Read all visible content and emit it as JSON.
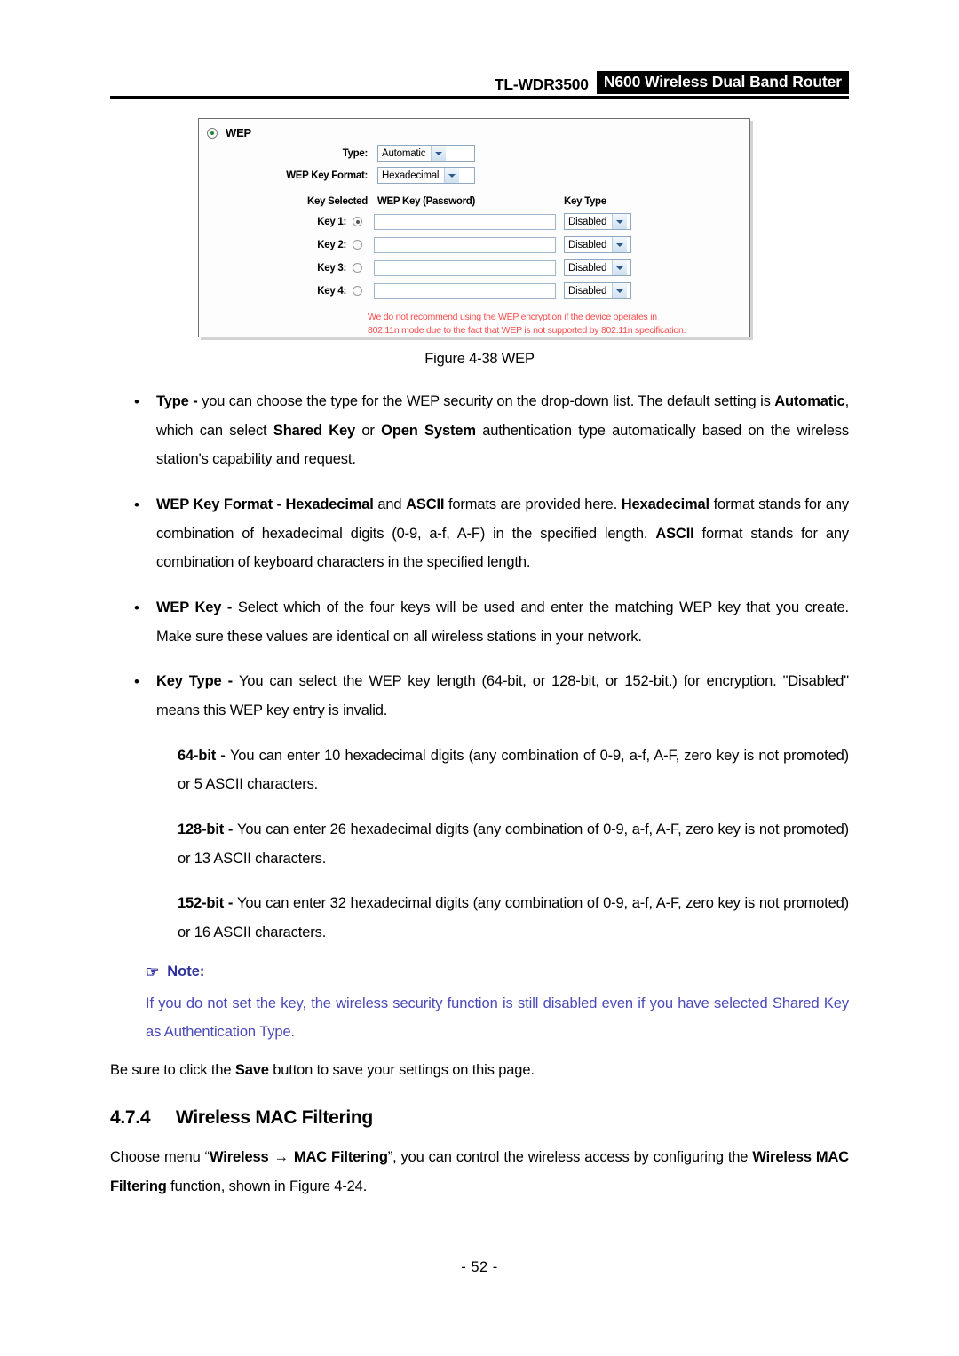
{
  "header": {
    "model": "TL-WDR3500",
    "product": "N600 Wireless Dual Band Router"
  },
  "wep_panel": {
    "section_label": "WEP",
    "section_radio_selected": true,
    "type_label": "Type:",
    "type_value": "Automatic",
    "key_format_label": "WEP Key Format:",
    "key_format_value": "Hexadecimal",
    "col_key_selected": "Key Selected",
    "col_wep_key": "WEP Key (Password)",
    "col_key_type": "Key Type",
    "keys": [
      {
        "label": "Key 1:",
        "selected": true,
        "value": "",
        "key_type": "Disabled"
      },
      {
        "label": "Key 2:",
        "selected": false,
        "value": "",
        "key_type": "Disabled"
      },
      {
        "label": "Key 3:",
        "selected": false,
        "value": "",
        "key_type": "Disabled"
      },
      {
        "label": "Key 4:",
        "selected": false,
        "value": "",
        "key_type": "Disabled"
      }
    ],
    "warning_line1": "We do not recommend using the WEP encryption if the device operates in",
    "warning_line2": "802.11n mode due to the fact that WEP is not supported by 802.11n specification.",
    "warning_color": "#ff4d4d"
  },
  "figure": {
    "caption": "Figure 4-38 WEP"
  },
  "bullets": {
    "marker": "•",
    "type": {
      "term": "Type - ",
      "text_1": "you can choose the type for the WEP security on the drop-down list. The default setting is ",
      "bold_1": "Automatic",
      "text_2": ", which can select ",
      "bold_2": "Shared Key",
      "text_3": " or ",
      "bold_3": "Open System",
      "text_4": " authentication type automatically based on the wireless station's capability and request."
    },
    "key_format": {
      "term": "WEP Key Format - ",
      "bold_1": "Hexadecimal",
      "text_1": " and ",
      "bold_2": "ASCII",
      "text_2": " formats are provided here. ",
      "bold_3": "Hexadecimal",
      "text_3": " format stands for any combination of hexadecimal digits (0-9, a-f, A-F) in the specified length. ",
      "bold_4": "ASCII",
      "text_4": " format stands for any combination of keyboard characters in the specified length."
    },
    "wep_key": {
      "term": "WEP Key - ",
      "text": "Select which of the four keys will be used and enter the matching WEP key that you create. Make sure these values are identical on all wireless stations in your network."
    },
    "key_type": {
      "term": "Key Type - ",
      "text": "You can select the WEP key length (64-bit, or 128-bit, or 152-bit.) for encryption. \"Disabled\" means this WEP key entry is invalid."
    }
  },
  "bit_paragraphs": [
    {
      "term": "64-bit - ",
      "text": " You can enter 10 hexadecimal digits (any combination of 0-9, a-f, A-F, zero key is not promoted) or 5 ASCII characters."
    },
    {
      "term": "128-bit - ",
      "text": "You can enter 26 hexadecimal digits (any combination of 0-9, a-f, A-F, zero key is not promoted) or 13 ASCII characters."
    },
    {
      "term": "152-bit - ",
      "text": "You can enter 32 hexadecimal digits (any combination of 0-9, a-f, A-F, zero key is not promoted) or 16 ASCII characters."
    }
  ],
  "note": {
    "pointer_icon": "☞",
    "title": "Note:",
    "body": "If you do not set the key, the wireless security function is still disabled even if you have selected Shared Key as Authentication Type.",
    "color": "#4a4ab8"
  },
  "save_para": {
    "text_1": "Be sure to click the ",
    "bold_1": "Save",
    "text_2": " button to save your settings on this page."
  },
  "section": {
    "number": "4.7.4",
    "title": "Wireless MAC Filtering"
  },
  "closing_para": {
    "text_1": "Choose menu “",
    "bold_1": "Wireless",
    "arrow": "→",
    "bold_2": "MAC Filtering",
    "text_2": "”, you can control the wireless access by configuring the ",
    "bold_3": "Wireless MAC Filtering",
    "text_3": " function, shown in Figure 4-24."
  },
  "footer": {
    "page_number": "- 52 -"
  }
}
